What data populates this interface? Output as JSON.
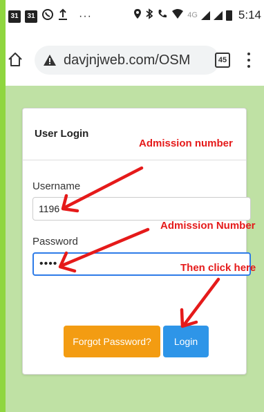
{
  "status_bar": {
    "calendar_day_1": "31",
    "calendar_day_2": "31",
    "dots": "···",
    "network_type": "4G",
    "time": "5:14"
  },
  "address_bar": {
    "url": "davjnjweb.com/OSM",
    "tab_count": "45"
  },
  "login_card": {
    "title": "User Login",
    "username_label": "Username",
    "username_value": "1196",
    "password_label": "Password",
    "password_value": "••••",
    "forgot_password_button": "Forgot Password?",
    "login_button": "Login"
  },
  "annotations": {
    "admission_number_1": "Admission number",
    "admission_number_2": "Admission Number",
    "then_click_here": "Then click here"
  },
  "colors": {
    "frame_green": "#8fd63f",
    "page_bg": "#bfe1a4",
    "forgot_orange": "#f39c12",
    "login_blue": "#2e95e8",
    "annotation_red": "#e51a1a"
  }
}
